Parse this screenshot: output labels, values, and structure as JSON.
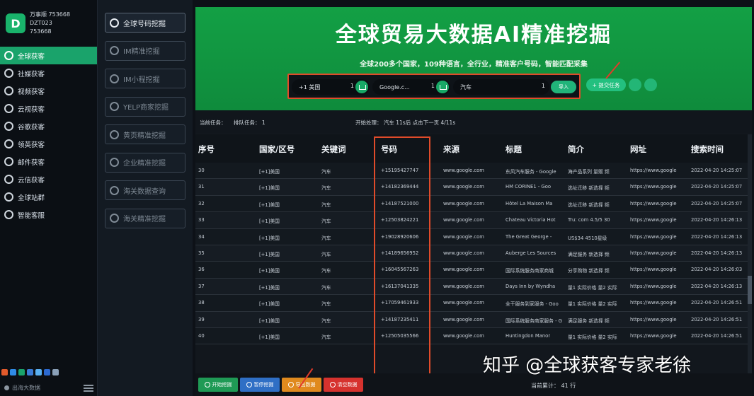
{
  "profile": {
    "line1": "万事顺 753668",
    "line2": "DZT023",
    "line3": "753668",
    "logo_letter": "D"
  },
  "sidebar": {
    "items": [
      {
        "label": "全球获客",
        "active": true
      },
      {
        "label": "社媒获客"
      },
      {
        "label": "视频获客"
      },
      {
        "label": "云视获客"
      },
      {
        "label": "谷歌获客"
      },
      {
        "label": "领英获客"
      },
      {
        "label": "邮件获客"
      },
      {
        "label": "云信获客"
      },
      {
        "label": "全球站群"
      },
      {
        "label": "智能客服"
      }
    ],
    "footer_label": "出海大数据"
  },
  "submenu": {
    "items": [
      {
        "label": "全球号码挖掘",
        "active": true,
        "icon": "globe-icon"
      },
      {
        "label": "IM精准挖掘",
        "icon": "chat-icon"
      },
      {
        "label": "IM小程挖掘",
        "icon": "chat-icon"
      },
      {
        "label": "YELP商家挖掘",
        "icon": "yelp-icon"
      },
      {
        "label": "黄页精准挖掘",
        "icon": "book-icon"
      },
      {
        "label": "企业精准挖掘",
        "icon": "building-icon"
      },
      {
        "label": "海关数据查询",
        "icon": "customs-icon"
      },
      {
        "label": "海关精准挖掘",
        "icon": "facebook-icon"
      }
    ]
  },
  "banner": {
    "title": "全球贸易大数据AI精准挖掘",
    "subtitle": "全球200多个国家，109种语言，全行业，精准客户号码，智能匹配采集"
  },
  "search": {
    "country": {
      "value": "+1 美国",
      "count": "1"
    },
    "engine": {
      "value": "Google.c...",
      "count": "1"
    },
    "keyword": {
      "value": "汽车",
      "count": "1"
    },
    "import_label": "导入",
    "start_label": "+ 提交任务"
  },
  "infobar": {
    "current_task": "当前任务：",
    "queue": "排队任务：  1",
    "status": "开始处理：  汽车  11s后  点击下一页 4/11s"
  },
  "table": {
    "columns": [
      "序号",
      "国家/区号",
      "关键词",
      "号码",
      "来源",
      "标题",
      "简介",
      "网址",
      "搜索时间"
    ],
    "rows": [
      [
        "30",
        "[+1]美国",
        "汽车",
        "+15195427747",
        "www.google.com",
        "东风汽车服务 - Google",
        "海产品系列  量贩  频",
        "https://www.google",
        "2022-04-20 14:25:07"
      ],
      [
        "31",
        "[+1]美国",
        "汽车",
        "+14182369444",
        "www.google.com",
        "HM CORINE1 - Goo",
        "选址迁移  新选择  频",
        "https://www.google",
        "2022-04-20 14:25:07"
      ],
      [
        "32",
        "[+1]美国",
        "汽车",
        "+14187521000",
        "www.google.com",
        "Hôtel La Maison Ma",
        "选址迁移  新选择  频",
        "https://www.google",
        "2022-04-20 14:25:07"
      ],
      [
        "33",
        "[+1]美国",
        "汽车",
        "+12503824221",
        "www.google.com",
        "Chateau Victoria Hot",
        "Tru: com  4.5/5  30",
        "https://www.google",
        "2022-04-20 14:26:13"
      ],
      [
        "34",
        "[+1]美国",
        "汽车",
        "+19028920606",
        "www.google.com",
        "The Great George -",
        "US$34  4510星级",
        "https://www.google",
        "2022-04-20 14:26:13"
      ],
      [
        "35",
        "[+1]美国",
        "汽车",
        "+14189656952",
        "www.google.com",
        "Auberge Les Sources",
        "满足服务  新选择  频",
        "https://www.google",
        "2022-04-20 14:26:13"
      ],
      [
        "36",
        "[+1]美国",
        "汽车",
        "+16045567263",
        "www.google.com",
        "国际系统服务商家商城",
        "分享购物  新选择  频",
        "https://www.google",
        "2022-04-20 14:26:03"
      ],
      [
        "37",
        "[+1]美国",
        "汽车",
        "+16137041335",
        "www.google.com",
        "Days Inn by Wyndha",
        "量1 实际价格  量2 实际",
        "https://www.google",
        "2022-04-20 14:26:13"
      ],
      [
        "38",
        "[+1]美国",
        "汽车",
        "+17059461933",
        "www.google.com",
        "全干服务到家服务 - Goo",
        "量1 实际价格  量2 实际",
        "https://www.google",
        "2022-04-20 14:26:51"
      ],
      [
        "39",
        "[+1]美国",
        "汽车",
        "+14187235411",
        "www.google.com",
        "国际系统服务商家服务 - G",
        "满足服务  新选择  频",
        "https://www.google",
        "2022-04-20 14:26:51"
      ],
      [
        "40",
        "[+1]美国",
        "汽车",
        "+12505035566",
        "www.google.com",
        "Huntingdon Manor",
        "量1 实际价格  量2 实际",
        "https://www.google",
        "2022-04-20 14:26:51"
      ]
    ]
  },
  "footer": {
    "buttons": [
      {
        "label": "开始挖掘",
        "color": "#1f9a55"
      },
      {
        "label": "暂停挖掘",
        "color": "#2f6fc5"
      },
      {
        "label": "导出数据",
        "color": "#e08a1e"
      },
      {
        "label": "清空数据",
        "color": "#d6322e"
      }
    ],
    "stats": "当前累计：  41  行"
  },
  "watermark": "知乎 @全球获客专家老徐",
  "colors": {
    "accent": "#1aa36b",
    "banner": "#13a045",
    "highlight": "#e04b2a"
  }
}
